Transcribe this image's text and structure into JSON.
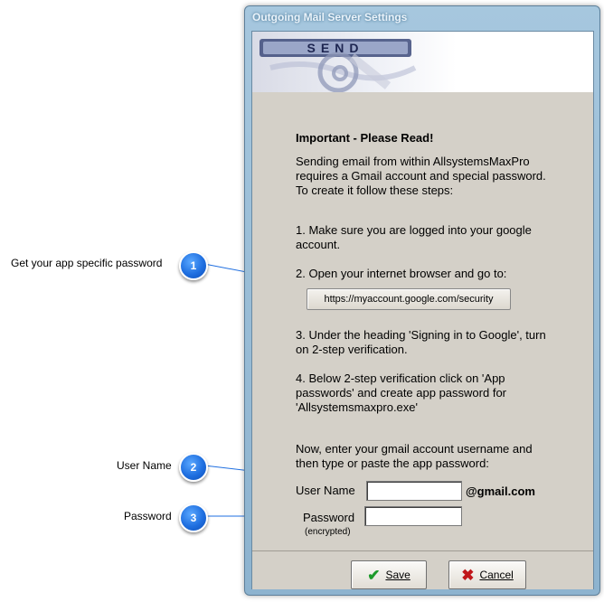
{
  "window": {
    "title": "Outgoing Mail Server Settings"
  },
  "banner": {
    "send_text": "SEND"
  },
  "callouts": [
    {
      "number": "1",
      "text": "Get your app specific password"
    },
    {
      "number": "2",
      "text": "User Name"
    },
    {
      "number": "3",
      "text": "Password"
    }
  ],
  "content": {
    "heading": "Important - Please Read!",
    "intro": "Sending email from within AllsystemsMaxPro requires a Gmail account and special password.  To create it follow these steps:",
    "step1": "1.  Make sure you are logged into your google account.",
    "step2": "2.  Open your internet browser and go to:",
    "url_button": "https://myaccount.google.com/security",
    "step3": "3.  Under the heading 'Signing in to Google', turn on 2-step verification.",
    "step4": "4.  Below 2-step verification click on 'App passwords' and create app password for 'Allsystemsmaxpro.exe'",
    "enter_text": "Now, enter your gmail account username and then type or paste the app password:"
  },
  "form": {
    "username_label": "User Name",
    "username_value": "",
    "username_suffix": "@gmail.com",
    "password_label": "Password",
    "password_value": "",
    "password_note": "(encrypted)"
  },
  "buttons": {
    "save": "Save",
    "cancel": "Cancel"
  },
  "colors": {
    "callout_blue": "#1f6fe0",
    "dialog_gray": "#d4d0c8",
    "save_green": "#1c9a2a",
    "cancel_red": "#c0161a"
  }
}
